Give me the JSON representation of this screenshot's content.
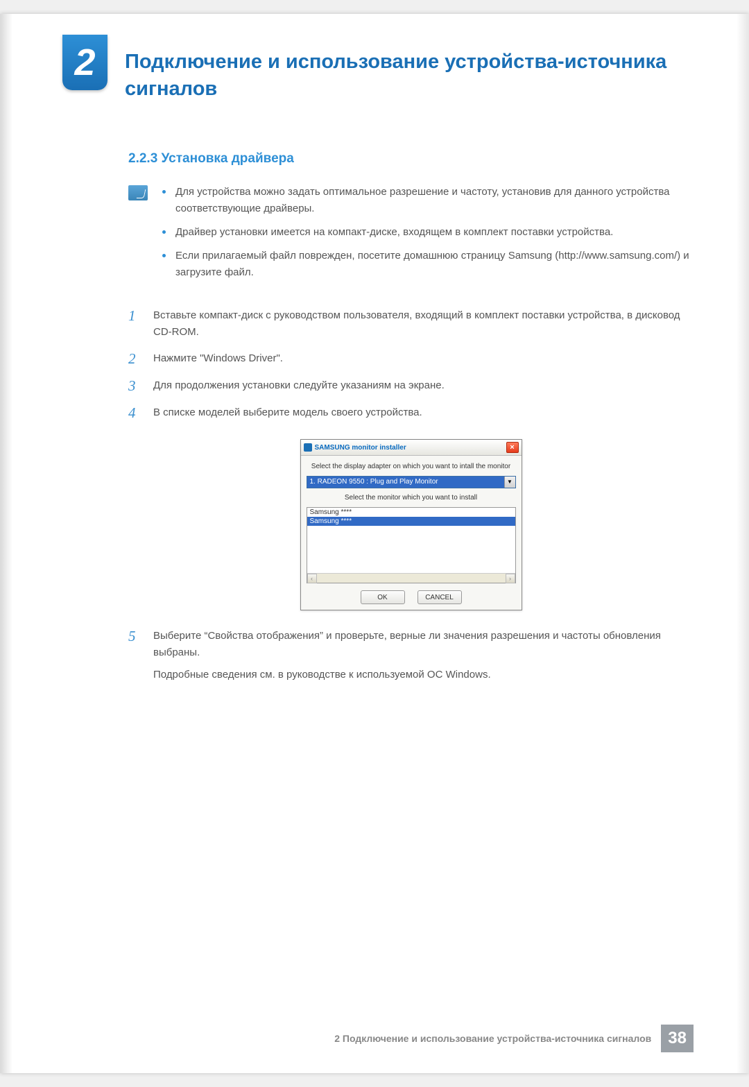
{
  "chapter": {
    "number": "2",
    "title": "Подключение и использование устройства-источника сигналов"
  },
  "section": {
    "number": "2.2.3",
    "title": "Установка драйвера"
  },
  "notes": [
    "Для устройства можно задать оптимальное разрешение и частоту, установив для данного устройства соответствующие драйверы.",
    "Драйвер установки имеется на компакт-диске, входящем в комплект поставки устройства.",
    "Если прилагаемый файл поврежден, посетите домашнюю страницу Samsung (http://www.samsung.com/) и загрузите файл."
  ],
  "steps": [
    {
      "n": "1",
      "text": "Вставьте компакт-диск с руководством пользователя, входящий в комплект поставки устройства, в дисковод CD-ROM."
    },
    {
      "n": "2",
      "text": "Нажмите \"Windows Driver\"."
    },
    {
      "n": "3",
      "text": "Для продолжения установки следуйте указаниям на экране."
    },
    {
      "n": "4",
      "text": "В списке моделей выберите модель своего устройства."
    },
    {
      "n": "5",
      "text": "Выберите “Свойства отображения” и проверьте, верные ли значения разрешения и частоты обновления выбраны.",
      "text2": "Подробные сведения см. в руководстве к используемой ОС Windows."
    }
  ],
  "installer": {
    "title": "SAMSUNG monitor installer",
    "label1": "Select the display adapter on which you want to intall the monitor",
    "dropdown": "1. RADEON 9550 : Plug and Play Monitor",
    "label2": "Select the monitor which you want to install",
    "items": [
      "Samsung ****",
      "Samsung ****"
    ],
    "ok": "OK",
    "cancel": "CANCEL"
  },
  "footer": {
    "text": "2 Подключение и использование устройства-источника сигналов",
    "page": "38"
  }
}
